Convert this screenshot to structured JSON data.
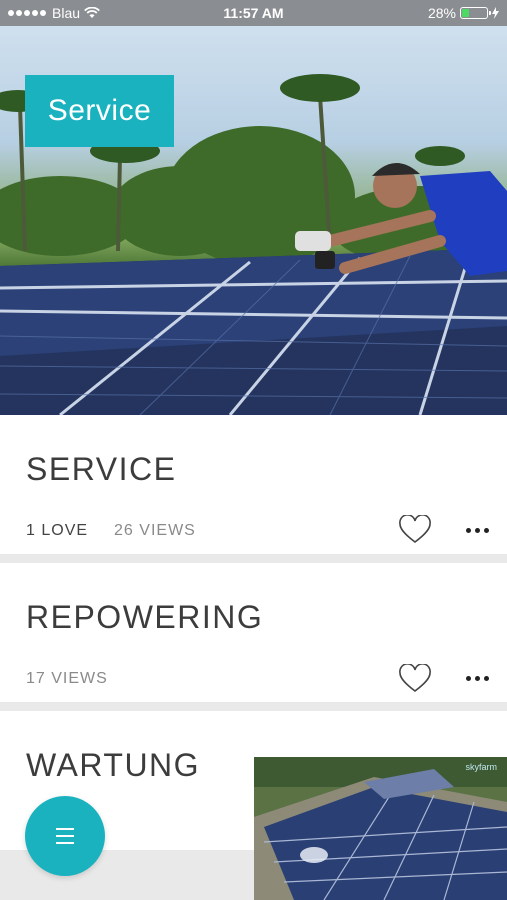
{
  "status_bar": {
    "carrier": "Blau",
    "time": "11:57 AM",
    "battery": "28%",
    "battery_level": 0.28
  },
  "hero": {
    "label": "Service"
  },
  "cards": [
    {
      "title": "SERVICE",
      "loves": "1 LOVE",
      "views": "26 VIEWS"
    },
    {
      "title": "REPOWERING",
      "views": "17 VIEWS"
    },
    {
      "title": "WARTUNG"
    }
  ],
  "thumbnail": {
    "watermark": "skyfarm"
  },
  "colors": {
    "accent": "#1ab2bf",
    "status_bar": "#8a8d91",
    "separator": "#e9e9e9"
  },
  "icons": [
    "wifi-icon",
    "battery-icon",
    "charging-icon",
    "heart-icon",
    "more-icon",
    "menu-icon"
  ]
}
